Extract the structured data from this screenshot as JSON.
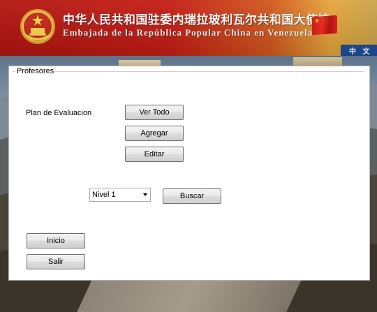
{
  "header": {
    "title_cn": "中华人民共和国驻委内瑞拉玻利瓦尔共和国大使馆",
    "title_es": "Embajada de la República Popular China en Venezuela",
    "lang_link": "中 文",
    "emblem_icon": "national-emblem-icon",
    "flag_icon": "china-flag-icon"
  },
  "form": {
    "group_title": "Profesores",
    "plan_label": "Plan de Evaluacion",
    "buttons": {
      "ver_todo": "Ver Todo",
      "agregar": "Agregar",
      "editar": "Editar",
      "buscar": "Buscar",
      "inicio": "Inicio",
      "salir": "Salir"
    },
    "nivel_select": {
      "selected": "Nivel 1"
    }
  },
  "colors": {
    "banner_red": "#c41c12",
    "banner_gold": "#e6a63a",
    "lang_strip": "#1f4e9a"
  }
}
